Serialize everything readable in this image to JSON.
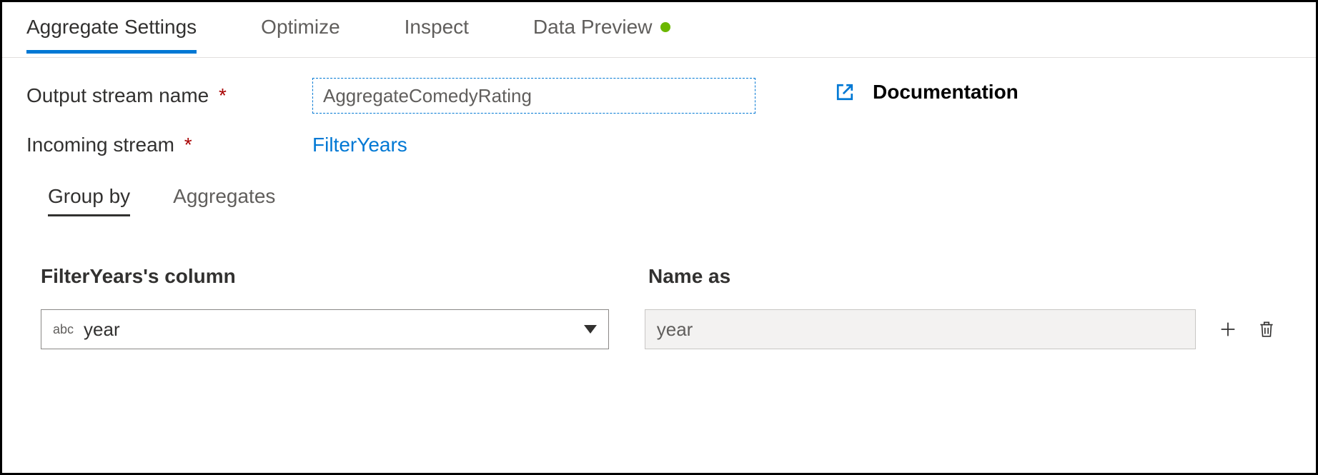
{
  "tabs": {
    "items": [
      {
        "label": "Aggregate Settings",
        "active": true
      },
      {
        "label": "Optimize",
        "active": false
      },
      {
        "label": "Inspect",
        "active": false
      },
      {
        "label": "Data Preview",
        "active": false,
        "status": "green"
      }
    ]
  },
  "form": {
    "output_stream_name_label": "Output stream name",
    "output_stream_name_value": "AggregateComedyRating",
    "incoming_stream_label": "Incoming stream",
    "incoming_stream_value": "FilterYears"
  },
  "documentation_label": "Documentation",
  "subtabs": {
    "group_by": "Group by",
    "aggregates": "Aggregates"
  },
  "groupby": {
    "column_header": "FilterYears's column",
    "name_as_header": "Name as",
    "type_badge": "abc",
    "column_value": "year",
    "name_as_value": "year"
  }
}
